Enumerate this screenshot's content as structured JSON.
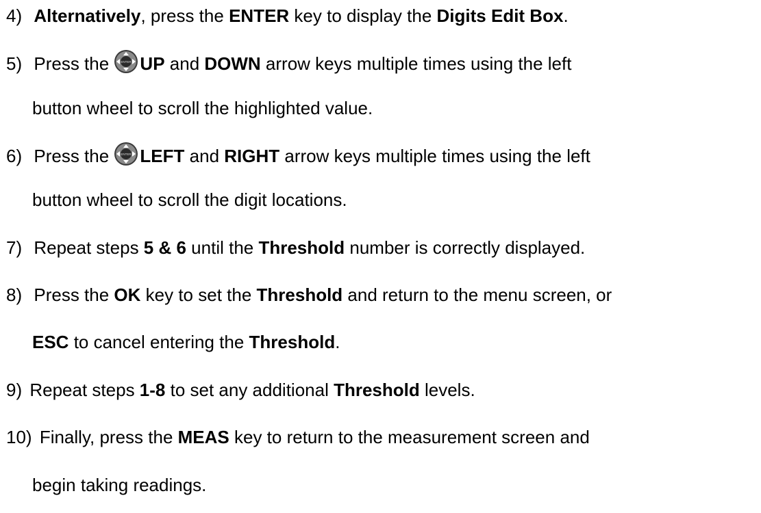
{
  "steps": [
    {
      "number": "4)",
      "parts": [
        "Alternatively",
        ", press the ",
        "ENTER",
        " key to display the ",
        "Digits Edit Box",
        "."
      ]
    },
    {
      "number": "5)",
      "line1": [
        "Press the",
        "UP",
        " and ",
        "DOWN",
        " arrow keys multiple times using the left"
      ],
      "line2": "button wheel to scroll the highlighted value."
    },
    {
      "number": "6)",
      "line1": [
        "Press the",
        "LEFT",
        " and ",
        "RIGHT",
        " arrow keys multiple times using the left"
      ],
      "line2": "button wheel to scroll the digit locations."
    },
    {
      "number": "7)",
      "parts": [
        "Repeat steps ",
        "5 & 6",
        " until the ",
        "Threshold",
        " number is correctly displayed."
      ]
    },
    {
      "number": "8)",
      "line1": [
        "Press the ",
        "OK",
        " key to set the ",
        "Threshold",
        " and return to the menu screen, or"
      ],
      "line2": [
        "ESC",
        " to cancel entering the ",
        "Threshold",
        "."
      ]
    },
    {
      "number": "9)",
      "parts": [
        "Repeat steps ",
        "1-8",
        " to set any additional ",
        "Threshold",
        " levels."
      ]
    },
    {
      "number": "10)",
      "line1": [
        "Finally, press the ",
        "MEAS",
        " key to return to the measurement screen and"
      ],
      "line2": "begin taking readings."
    }
  ],
  "icons": {
    "button_wheel": "button-wheel-icon",
    "wheel_center_label": "ENTER"
  },
  "colors": {
    "text": "#000000",
    "icon_dark": "#3a3a3a",
    "icon_light": "#d8d8d8"
  }
}
